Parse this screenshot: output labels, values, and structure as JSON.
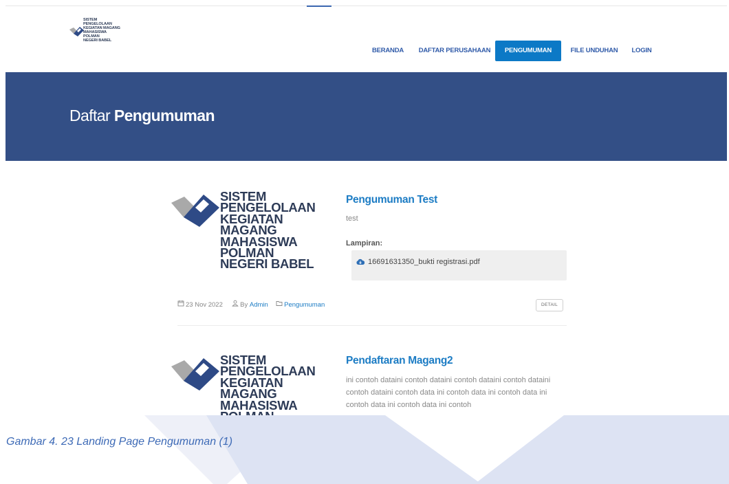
{
  "header": {
    "logo_lines": [
      "SISTEM",
      "PENGELOLAAN",
      "KEGIATAN MAGANG",
      "MAHASISWA",
      "POLMAN",
      "NEGERI BABEL"
    ]
  },
  "nav": {
    "items": [
      {
        "label": "BERANDA",
        "active": false
      },
      {
        "label": "DAFTAR PERUSAHAAN",
        "active": false
      },
      {
        "label": "PENGUMUMAN",
        "active": true
      },
      {
        "label": "FILE UNDUHAN",
        "active": false
      },
      {
        "label": "LOGIN",
        "active": false
      }
    ]
  },
  "hero": {
    "title_prefix": "Daftar",
    "title_bold": "Pengumuman"
  },
  "posts": [
    {
      "title": "Pengumuman Test",
      "excerpt": "test",
      "attachment_label": "Lampiran:",
      "attachment_file": "16691631350_bukti registrasi.pdf",
      "date": "23 Nov 2022",
      "by_prefix": "By",
      "author": "Admin",
      "category": "Pengumuman",
      "detail_label": "DETAIL"
    },
    {
      "title": "Pendaftaran Magang2",
      "excerpt": "ini contoh dataini contoh dataini contoh dataini contoh dataini contoh dataini contoh data ini contoh data ini contoh data ini contoh data ini contoh data ini contoh"
    }
  ],
  "caption": "Gambar 4. 23 Landing Page Pengumuman (1)",
  "colors": {
    "hero_bg": "#334f86",
    "nav_active_bg": "#0c79c6",
    "nav_text": "#2f5aa8",
    "title_blue": "#1c7cc4",
    "caption": "#3d6ab6"
  }
}
